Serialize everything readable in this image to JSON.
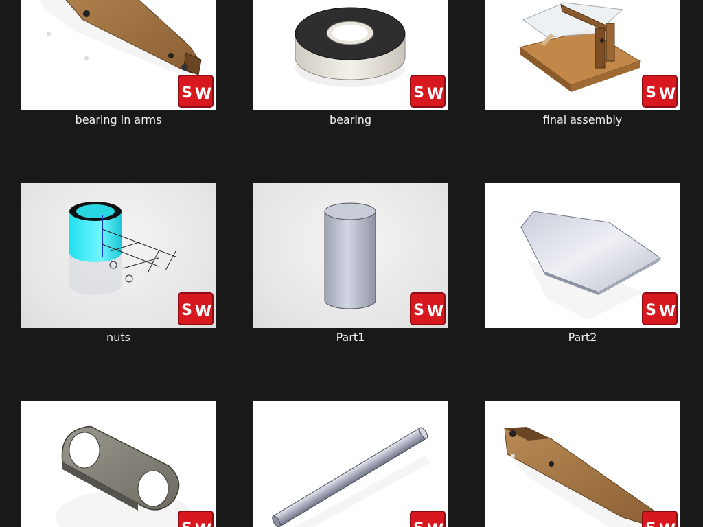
{
  "files": [
    {
      "name": "bearing in arms",
      "thumb": "wooden-arm-with-bearing"
    },
    {
      "name": "bearing",
      "thumb": "ring-bearing"
    },
    {
      "name": "final assembly",
      "thumb": "wood-assembly-with-plate"
    },
    {
      "name": "nuts",
      "thumb": "cyan-cylinder-drawing"
    },
    {
      "name": "Part1",
      "thumb": "grey-cylinder"
    },
    {
      "name": "Part2",
      "thumb": "hexagonal-plate"
    },
    {
      "name": "",
      "thumb": "two-hole-link"
    },
    {
      "name": "",
      "thumb": "metal-rod"
    },
    {
      "name": "",
      "thumb": "wooden-arm"
    }
  ],
  "badge": {
    "text_s": "S",
    "text_w": "W",
    "color": "#d7191f"
  }
}
